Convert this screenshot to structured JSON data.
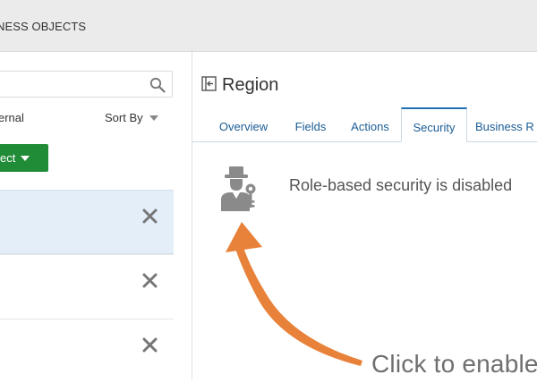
{
  "header": {
    "title": "NESS OBJECTS"
  },
  "left_pane": {
    "search": {
      "placeholder": ""
    },
    "filter_label": "ernal",
    "sort_label": "Sort By",
    "select_button_label": "ect",
    "rows": [
      {
        "selected": true
      },
      {
        "selected": false
      },
      {
        "selected": false
      }
    ]
  },
  "detail": {
    "title": "Region",
    "tabs": [
      {
        "label": "Overview",
        "active": false
      },
      {
        "label": "Fields",
        "active": false
      },
      {
        "label": "Actions",
        "active": false
      },
      {
        "label": "Security",
        "active": true
      },
      {
        "label": "Business R",
        "active": false
      }
    ],
    "security_message": "Role-based security is disabled"
  },
  "annotation": {
    "text": "Click to enable",
    "color": "#e8823a"
  },
  "colors": {
    "accent_green": "#218c38",
    "tab_blue": "#1c5d96",
    "selected_row": "#e3eef8"
  }
}
